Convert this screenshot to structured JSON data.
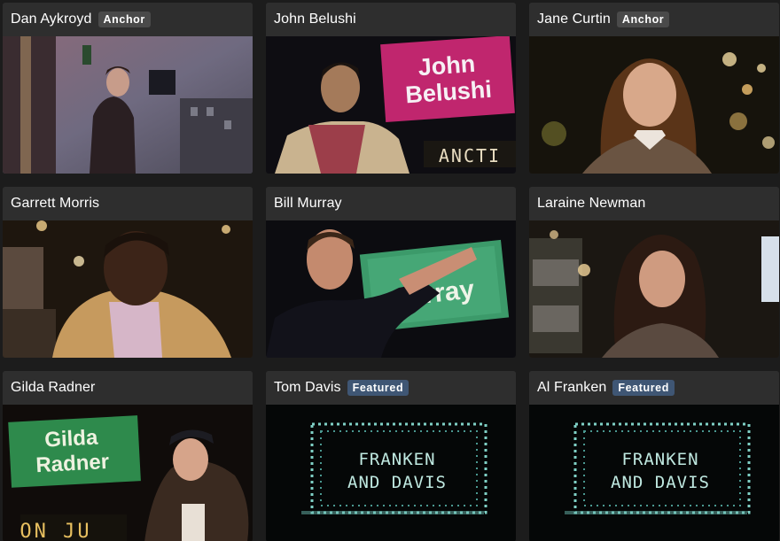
{
  "cast": [
    {
      "name": "Dan Aykroyd",
      "badge": "Anchor",
      "thumb": "thumbnail-dan-aykroyd-times-square"
    },
    {
      "name": "John Belushi",
      "badge": "",
      "thumb": "thumbnail-john-belushi-marquee",
      "sign_line1": "John",
      "sign_line2": "Belushi",
      "ticker": "ANCTI"
    },
    {
      "name": "Jane Curtin",
      "badge": "Anchor",
      "thumb": "thumbnail-jane-curtin-night"
    },
    {
      "name": "Garrett Morris",
      "badge": "",
      "thumb": "thumbnail-garrett-morris-night"
    },
    {
      "name": "Bill Murray",
      "badge": "",
      "thumb": "thumbnail-bill-murray-sign",
      "sign_line2": "rray"
    },
    {
      "name": "Laraine Newman",
      "badge": "",
      "thumb": "thumbnail-laraine-newman-night"
    },
    {
      "name": "Gilda Radner",
      "badge": "",
      "thumb": "thumbnail-gilda-radner-sign",
      "sign_line1": "Gilda",
      "sign_line2": "Radner",
      "ticker": "ON JU"
    },
    {
      "name": "Tom Davis",
      "badge": "Featured",
      "thumb": "thumbnail-franken-and-davis-marquee",
      "sign_line1": "FRANKEN",
      "sign_line2": "AND DAVIS"
    },
    {
      "name": "Al Franken",
      "badge": "Featured",
      "thumb": "thumbnail-franken-and-davis-marquee",
      "sign_line1": "FRANKEN",
      "sign_line2": "AND DAVIS"
    }
  ],
  "colors": {
    "page_bg": "#1c1c1c",
    "card_bg": "#2b2b2b",
    "anchor_badge": "#4a4a4a",
    "featured_badge": "#3f5674"
  }
}
